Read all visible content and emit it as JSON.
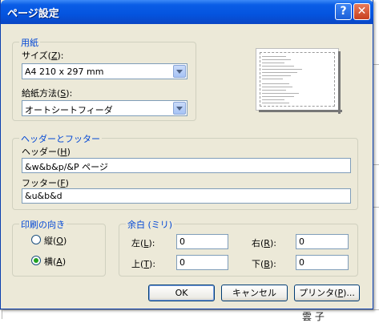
{
  "window": {
    "title": "ページ設定",
    "help_label": "?",
    "close_label": "✕"
  },
  "paper": {
    "legend": "用紙",
    "size_label": "サイズ(",
    "size_key": "Z",
    "size_label_end": "):",
    "size_value": "A4 210 x 297 mm",
    "source_label": "給紙方法(",
    "source_key": "S",
    "source_label_end": "):",
    "source_value": "オートシートフィーダ"
  },
  "header_footer": {
    "legend": "ヘッダーとフッター",
    "header_label": "ヘッダー(",
    "header_key": "H",
    "header_label_end": ")",
    "header_value": "&w&b&p/&P ページ",
    "footer_label": "フッター(",
    "footer_key": "F",
    "footer_label_end": ")",
    "footer_value": "&u&b&d"
  },
  "orientation": {
    "legend": "印刷の向き",
    "portrait_label": "縦(",
    "portrait_key": "O",
    "portrait_label_end": ")",
    "landscape_label": "横(",
    "landscape_key": "A",
    "landscape_label_end": ")",
    "selected": "landscape"
  },
  "margins": {
    "legend": "余白 (ミリ)",
    "left_label": "左(",
    "left_key": "L",
    "left_value": "0",
    "right_label": "右(",
    "right_key": "R",
    "right_value": "0",
    "top_label": "上(",
    "top_key": "T",
    "top_value": "0",
    "bottom_label": "下(",
    "bottom_key": "B",
    "bottom_value": "0",
    "label_end": "):"
  },
  "buttons": {
    "ok": "OK",
    "cancel": "キャンセル",
    "printer": "プリンタ(",
    "printer_key": "P",
    "printer_end": ")..."
  },
  "background": {
    "bottom_text": "雲 子"
  }
}
